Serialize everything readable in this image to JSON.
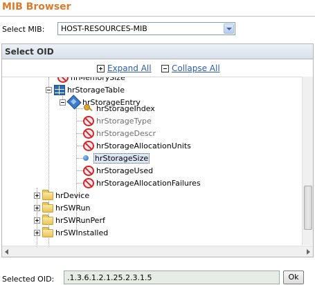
{
  "app": {
    "title": "MIB Browser"
  },
  "mib_select": {
    "label": "Select MIB:",
    "value": "HOST-RESOURCES-MIB"
  },
  "oid_panel": {
    "title": "Select OID",
    "expand_all": "Expand All",
    "collapse_all": "Collapse All"
  },
  "tree": {
    "partial_top": "hrMemorySize",
    "table": "hrStorageTable",
    "entry": "hrStorageEntry",
    "columns": [
      {
        "label": "hrStorageIndex",
        "icon": "key-icon",
        "style": "normal"
      },
      {
        "label": "hrStorageType",
        "icon": "no-access-icon",
        "style": "grey"
      },
      {
        "label": "hrStorageDescr",
        "icon": "no-access-icon",
        "style": "grey"
      },
      {
        "label": "hrStorageAllocationUnits",
        "icon": "no-access-icon",
        "style": "normal"
      },
      {
        "label": "hrStorageSize",
        "icon": "leaf-dot-icon",
        "style": "selected"
      },
      {
        "label": "hrStorageUsed",
        "icon": "no-access-icon",
        "style": "normal"
      },
      {
        "label": "hrStorageAllocationFailures",
        "icon": "no-access-icon",
        "style": "normal"
      }
    ],
    "folders": [
      "hrDevice",
      "hrSWRun",
      "hrSWRunPerf",
      "hrSWInstalled"
    ]
  },
  "selected_oid": {
    "label": "Selected OID:",
    "value": ".1.3.6.1.2.1.25.2.3.1.5"
  },
  "ok_button": {
    "label": "Ok"
  },
  "colors": {
    "title": "#d87b2d",
    "link": "#2a5db0",
    "selection": "#dbe6f6"
  }
}
